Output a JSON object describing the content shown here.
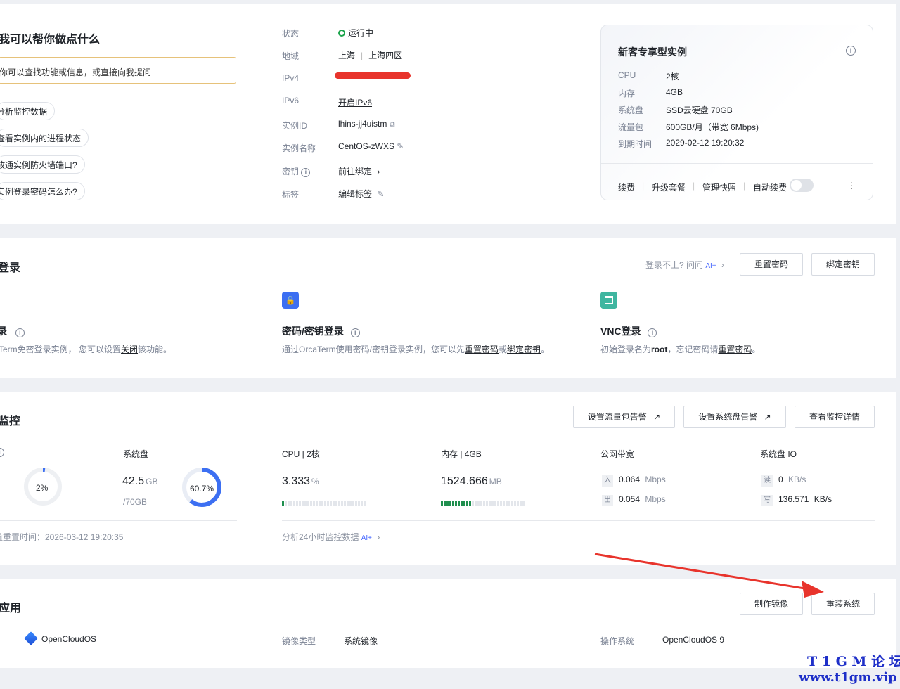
{
  "assistant": {
    "title": "我可以帮你做点什么",
    "input_placeholder": "你可以查找功能或信息，或直接向我提问",
    "chips": [
      "分析监控数据",
      "查看实例内的进程状态",
      "放通实例防火墙端口?",
      "实例登录密码怎么办?"
    ]
  },
  "instance": {
    "labels": {
      "status": "状态",
      "region": "地域",
      "ipv4": "IPv4",
      "ipv6": "IPv6",
      "id": "实例ID",
      "name": "实例名称",
      "key": "密钥",
      "tags": "标签"
    },
    "status": "运行中",
    "region": "上海",
    "zone": "上海四区",
    "ipv6_action": "开启IPv6",
    "id": "lhins-jj4uistm",
    "name": "CentOS-zWXS",
    "key_action": "前往绑定",
    "tag_action": "编辑标签"
  },
  "package": {
    "title": "新客专享型实例",
    "rows": [
      {
        "label": "CPU",
        "value": "2核"
      },
      {
        "label": "内存",
        "value": "4GB"
      },
      {
        "label": "系统盘",
        "value": "SSD云硬盘 70GB"
      },
      {
        "label": "流量包",
        "value": "600GB/月（带宽 6Mbps)"
      },
      {
        "label": "到期时间",
        "value": "2029-02-12 19:20:32"
      }
    ],
    "actions": [
      "续费",
      "升级套餐",
      "管理快照"
    ],
    "auto_renew": "自动续费",
    "more": "⋮"
  },
  "login": {
    "title": "登录",
    "help": "登录不上? 问问",
    "ai": "AI+",
    "reset_btn": "重置密码",
    "bind_btn": "绑定密钥",
    "m1_title": "录",
    "m1_desc_a": "Term免密登录实例，  您可以设置",
    "m1_link": "关闭",
    "m1_desc_b": "该功能。",
    "m2_title": "密码/密钥登录",
    "m2_desc_a": "通过OrcaTerm使用密码/密钥登录实例，您可以先",
    "m2_link1": "重置密码",
    "m2_or": "或",
    "m2_link2": "绑定密钥",
    "m2_end": "。",
    "m3_title": "VNC登录",
    "m3_desc_a": "初始登录名为",
    "m3_root": "root",
    "m3_desc_b": "，忘记密码请",
    "m3_link": "重置密码",
    "m3_end": "。"
  },
  "monitor": {
    "title": "监控",
    "btn_traffic": "设置流量包告警",
    "btn_disk": "设置系统盘告警",
    "btn_detail": "查看监控详情",
    "traffic_pct": "2%",
    "traffic_pct_value": 2,
    "disk_label": "系统盘",
    "disk_used": "42.5",
    "disk_unit": "GB",
    "disk_total": "/70GB",
    "disk_pct": "60.7%",
    "disk_pct_value": 60.7,
    "reset_time": "量重置时间：2026-03-12 19:20:35",
    "cpu_label": "CPU | 2核",
    "cpu_value": "3.333",
    "cpu_unit": "%",
    "cpu_fraction": 0.03,
    "mem_label": "内存 | 4GB",
    "mem_value": "1524.666",
    "mem_unit": "MB",
    "mem_fraction": 0.37,
    "analyze": "分析24小时监控数据",
    "ai": "AI+",
    "bw_label": "公网带宽",
    "bw_in_tag": "入",
    "bw_in": "0.064",
    "bw_out_tag": "出",
    "bw_out": "0.054",
    "bw_unit": "Mbps",
    "io_label": "系统盘 IO",
    "io_read_tag": "读",
    "io_read": "0",
    "io_write_tag": "写",
    "io_write": "136.571",
    "io_unit": "KB/s"
  },
  "app": {
    "title": "应用",
    "btn_image": "制作镜像",
    "btn_reinstall": "重装系统",
    "os_name": "OpenCloudOS",
    "image_type_label": "镜像类型",
    "image_type": "系统镜像",
    "os_label": "操作系统",
    "os_value": "OpenCloudOS 9"
  },
  "watermark": {
    "line1": "T 1 G M 论 坛",
    "line2": "www.t1gm.vip"
  },
  "colors": {
    "accent": "#0052d9",
    "running": "#1aa34a",
    "annotation_red": "#e8342c"
  }
}
